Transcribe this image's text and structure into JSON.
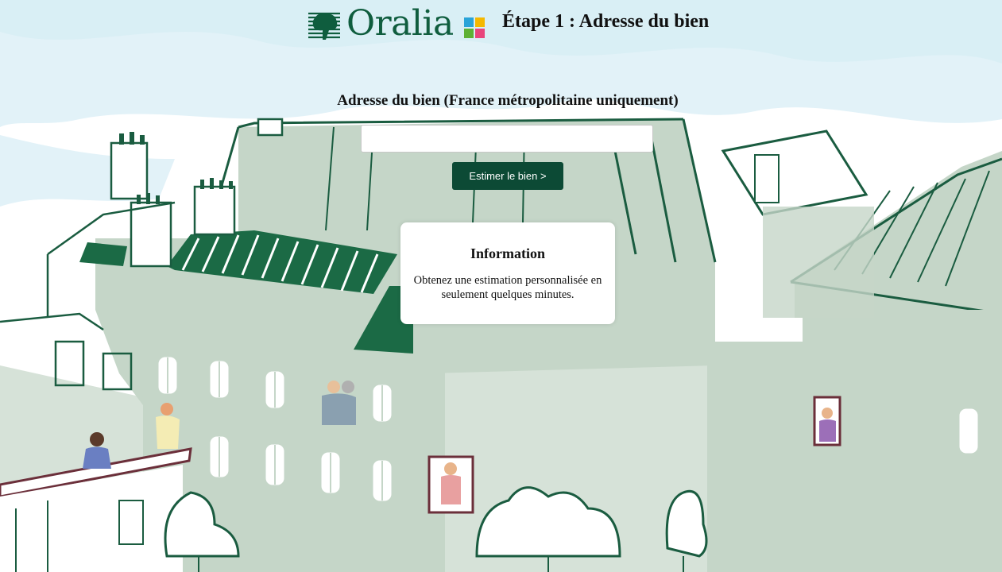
{
  "header": {
    "brand": "Oralia",
    "step_title": "Étape 1 : Adresse du bien",
    "brand_colors": {
      "green": "#0f5d3e",
      "square_blue": "#2aa4d8",
      "square_yellow": "#f5b800",
      "square_green": "#5eb135",
      "square_pink": "#e8457c"
    }
  },
  "form": {
    "label": "Adresse du bien (France métropolitaine uniquement)",
    "address_value": "",
    "address_placeholder": "",
    "submit_label": "Estimer le bien >"
  },
  "info": {
    "title": "Information",
    "text": "Obtenez une estimation personnalisée en seulement quelques minutes."
  },
  "colors": {
    "button": "#0c4a35",
    "illustration_green": "#1a5c40",
    "illustration_wash": "#c5d6c8",
    "sky_wash": "#dff0f6"
  }
}
